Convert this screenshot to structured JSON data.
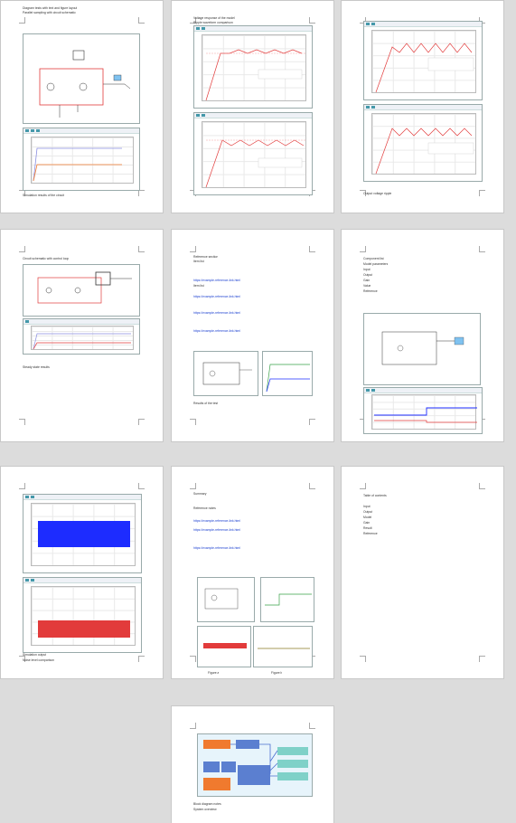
{
  "pages": [
    {
      "id": 1,
      "lines": [
        "Diagram tests with text and figure layout",
        "Parallel sampling with circuit schematic"
      ],
      "caption": "Simulation results of the circuit"
    },
    {
      "id": 2,
      "lines": [
        "Voltage response of the model",
        "Ripple waveform comparison"
      ],
      "caption": ""
    },
    {
      "id": 3,
      "lines": [],
      "caption": "Output voltage ripple"
    },
    {
      "id": 4,
      "lines": [
        "Circuit schematic with control loop"
      ],
      "caption": "Steady state results"
    },
    {
      "id": 5,
      "lines": [
        "Reference section",
        "Item list",
        "Item list"
      ],
      "links": [
        "https://example-reference-link.html",
        "https://example-reference-link.html",
        "https://example-reference-link.html",
        "https://example-reference-link.html"
      ],
      "caption": "Results of the test"
    },
    {
      "id": 6,
      "lines": [
        "Component list",
        "Model parameters",
        "Input",
        "Output",
        "Gain",
        "Value",
        "Reference"
      ],
      "caption": ""
    },
    {
      "id": 7,
      "lines": [
        "Simulation output",
        "Noise level comparison"
      ],
      "caption": ""
    },
    {
      "id": 8,
      "lines": [
        "Summary",
        "Reference notes"
      ],
      "links": [
        "https://example-reference-link.html",
        "https://example-reference-link.html",
        "https://example-reference-link.html"
      ],
      "captions": [
        "Figure a",
        "Figure b"
      ]
    },
    {
      "id": 9,
      "lines": [
        "Table of contents",
        "Input",
        "Output",
        "Model",
        "Gain",
        "Result",
        "Reference"
      ],
      "caption": ""
    },
    {
      "id": 10,
      "lines": [
        "Block diagram notes",
        "System overview"
      ],
      "caption": ""
    }
  ],
  "colors": {
    "plot_red": "#e23b3b",
    "plot_blue": "#1d2cff",
    "plot_green": "#3aa24a",
    "plot_orange": "#f07a2e",
    "diagram_blue": "#5b7fd0",
    "diagram_teal": "#7fd1c8"
  }
}
